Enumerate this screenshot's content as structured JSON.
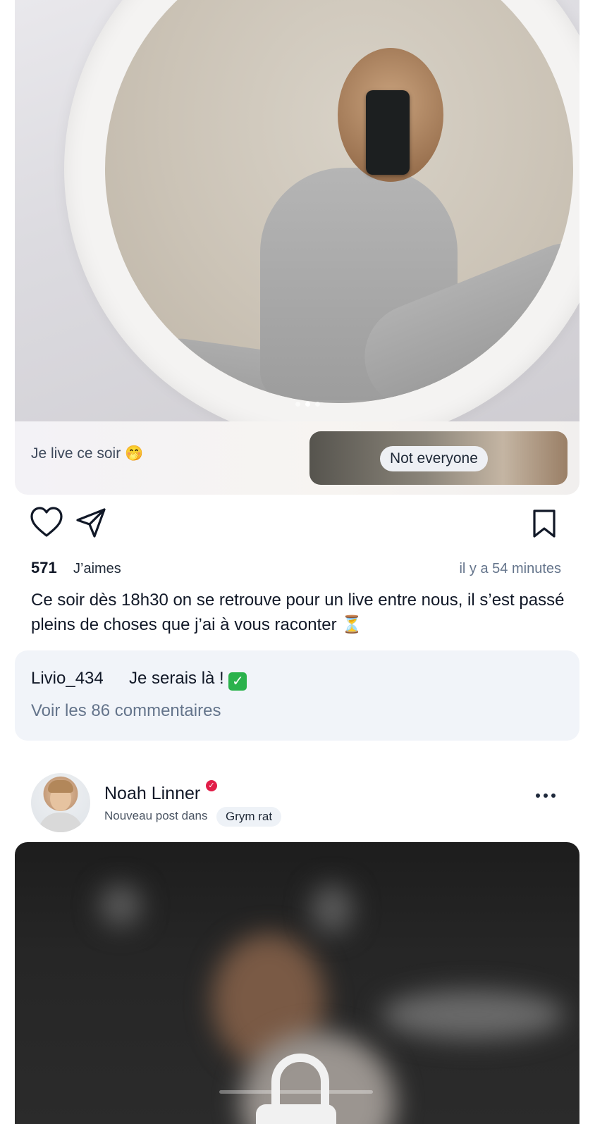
{
  "post1": {
    "caption_strip": "Je live ce soir 🤭",
    "teaser_label": "Not everyone",
    "likes_count": "571",
    "likes_label": "J’aimes",
    "time_ago": "il y a 54 minutes",
    "caption": "Ce soir dès 18h30 on se retrouve pour un live entre nous, il s’est passé pleins de choses que j’ai à vous raconter ⏳",
    "carousel": {
      "current": 2,
      "total": 3
    },
    "comment": {
      "user": "Livio_434",
      "text": "Je serais là !",
      "emoji": "✓"
    },
    "view_comments": "Voir les 86 commentaires"
  },
  "post2": {
    "author": "Noah Linner",
    "verified_icon": "✓",
    "subtitle": "Nouveau post dans",
    "group": "Grym rat"
  },
  "colors": {
    "accent_verified": "#e11d48",
    "comment_bg": "#f1f4f9",
    "muted_text": "#64748b"
  },
  "icons": [
    "heart-icon",
    "send-icon",
    "bookmark-icon",
    "more-icon",
    "lock-icon",
    "verified-icon"
  ]
}
